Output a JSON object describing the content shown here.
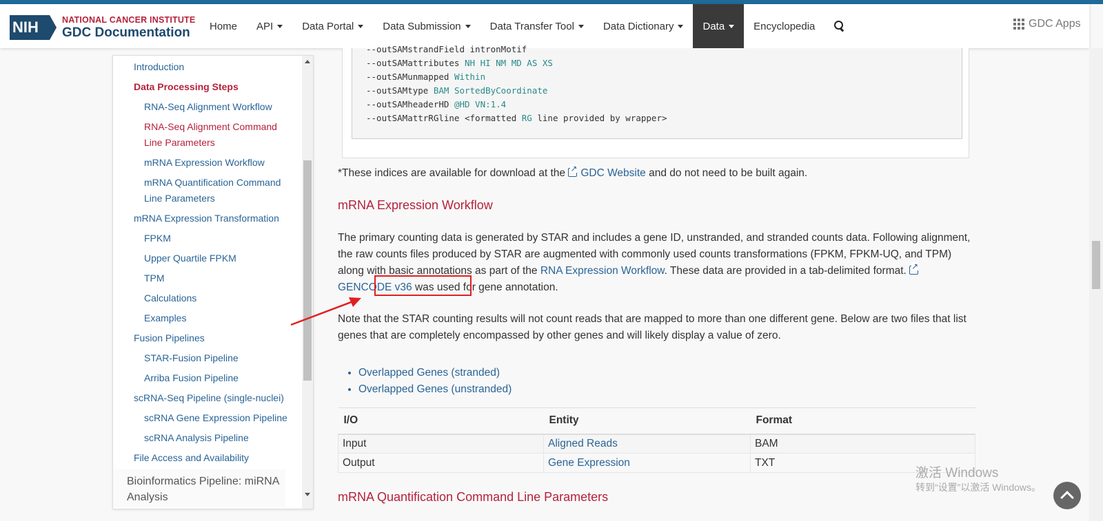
{
  "header": {
    "logo_mark": "NIH",
    "logo_line1": "NATIONAL CANCER INSTITUTE",
    "logo_line2": "GDC Documentation",
    "nav": [
      {
        "label": "Home"
      },
      {
        "label": "API"
      },
      {
        "label": "Data Portal"
      },
      {
        "label": "Data Submission"
      },
      {
        "label": "Data Transfer Tool"
      },
      {
        "label": "Data Dictionary"
      },
      {
        "label": "Data"
      },
      {
        "label": "Encyclopedia"
      }
    ],
    "apps_label": "GDC Apps"
  },
  "sidebar": {
    "items": [
      {
        "label": "Introduction"
      },
      {
        "label": "Data Processing Steps"
      },
      {
        "label": "RNA-Seq Alignment Workflow"
      },
      {
        "label": "RNA-Seq Alignment Command Line Parameters"
      },
      {
        "label": "mRNA Expression Workflow"
      },
      {
        "label": "mRNA Quantification Command Line Parameters"
      },
      {
        "label": "mRNA Expression Transformation"
      },
      {
        "label": "FPKM"
      },
      {
        "label": "Upper Quartile FPKM"
      },
      {
        "label": "TPM"
      },
      {
        "label": "Calculations"
      },
      {
        "label": "Examples"
      },
      {
        "label": "Fusion Pipelines"
      },
      {
        "label": "STAR-Fusion Pipeline"
      },
      {
        "label": "Arriba Fusion Pipeline"
      },
      {
        "label": "scRNA-Seq Pipeline (single-nuclei)"
      },
      {
        "label": "scRNA Gene Expression Pipeline"
      },
      {
        "label": "scRNA Analysis Pipeline"
      },
      {
        "label": "File Access and Availability"
      },
      {
        "label": "Bioinformatics Pipeline: miRNA Analysis"
      }
    ]
  },
  "code": {
    "lines": [
      {
        "key": "--outSAMstrandField ",
        "val": "intronMotif",
        "rest": ""
      },
      {
        "key": "--outSAMattributes ",
        "val": "NH HI NM MD AS XS",
        "rest": ""
      },
      {
        "key": "--outSAMunmapped ",
        "val": "Within",
        "rest": ""
      },
      {
        "key": "--outSAMtype ",
        "val": "BAM SortedByCoordinate",
        "rest": ""
      },
      {
        "key": "--outSAMheaderHD ",
        "val": "@HD VN:1.4",
        "rest": ""
      },
      {
        "key": "--outSAMattrRGline <formatted ",
        "val": "RG",
        "rest": " line provided by wrapper>"
      }
    ]
  },
  "content": {
    "indices_pre": "*These indices are available for download at the",
    "indices_link": "GDC Website",
    "indices_post": "and do not need to be built again.",
    "section_title": "mRNA Expression Workflow",
    "para1_a": "The primary counting data is generated by STAR and includes a gene ID, unstranded, and stranded counts data. Following alignment, the raw counts files produced by STAR are augmented with commonly used counts transformations (FPKM, FPKM-UQ, and TPM) along with basic annotations as part of the",
    "para1_link": "RNA Expression Workflow",
    "para1_b": ". These data are provided in a tab-delimited format.",
    "gencode_link": "GENCODE v36",
    "para1_c": "was used for gene annotation.",
    "para2": "Note that the STAR counting results will not count reads that are mapped to more than one different gene. Below are two files that list genes that are completely encompassed by other genes and will likely display a value of zero.",
    "bullets": [
      {
        "label": "Overlapped Genes (stranded)"
      },
      {
        "label": "Overlapped Genes (unstranded)"
      }
    ],
    "table": {
      "headers": [
        "I/O",
        "Entity",
        "Format"
      ],
      "rows": [
        [
          "Input",
          "Aligned Reads",
          "BAM"
        ],
        [
          "Output",
          "Gene Expression",
          "TXT"
        ]
      ]
    },
    "next_title": "mRNA Quantification Command Line Parameters"
  },
  "overlay": {
    "watermark_line1": "激活 Windows",
    "watermark_line2": "转到“设置”以激活 Windows。"
  },
  "colors": {
    "accent_red": "#b5223b",
    "link_blue": "#2a6496",
    "nav_active": "#3a3a3a",
    "highlight_box": "#e02020"
  }
}
